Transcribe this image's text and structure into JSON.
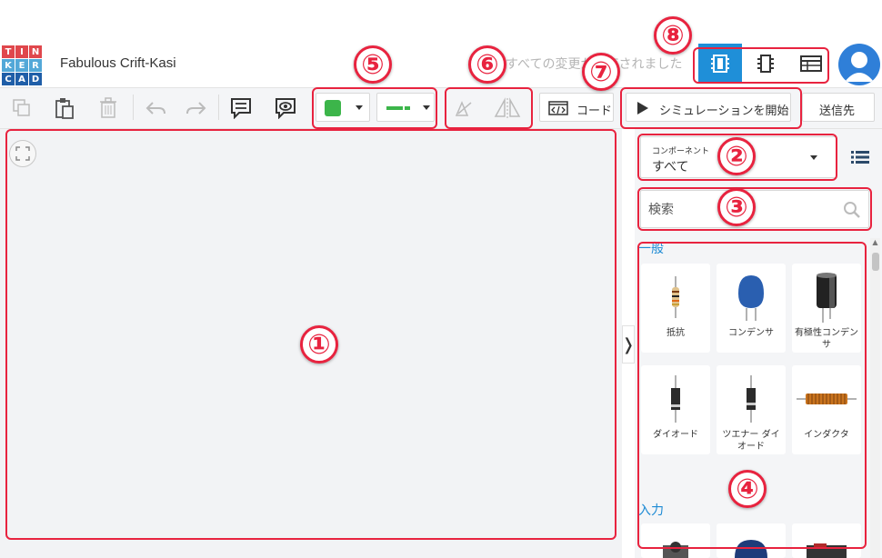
{
  "app": {
    "logo_letters": [
      "T",
      "I",
      "N",
      "K",
      "E",
      "R",
      "C",
      "A",
      "D"
    ],
    "logo_colors": [
      "#e0474c",
      "#e0474c",
      "#e0474c",
      "#53a8d8",
      "#53a8d8",
      "#53a8d8",
      "#1f5ea8",
      "#1f5ea8",
      "#1f5ea8"
    ],
    "project_title": "Fabulous Crift-Kasi",
    "save_status": "すべての変更が保存されました"
  },
  "header": {
    "view_buttons": [
      {
        "icon": "circuit-view-icon",
        "active": true
      },
      {
        "icon": "schematic-view-icon",
        "active": false
      },
      {
        "icon": "component-list-view-icon",
        "active": false
      }
    ],
    "accent_color": "#1f8fd8"
  },
  "toolbar": {
    "code_label": "コード",
    "simulate_label": "シミュレーションを開始",
    "send_label": "送信先",
    "fill_color": "#3cb54a",
    "wire_color": "#3cb54a"
  },
  "panel": {
    "components_small_label": "コンポーネント",
    "components_value": "すべて",
    "search_placeholder": "検索",
    "section_general": "一般",
    "section_input": "入力",
    "general_items": [
      {
        "label": "抵抗",
        "icon": "resistor-icon"
      },
      {
        "label": "コンデンサ",
        "icon": "capacitor-icon"
      },
      {
        "label": "有極性コンデンサ",
        "icon": "polarized-capacitor-icon"
      },
      {
        "label": "ダイオード",
        "icon": "diode-icon"
      },
      {
        "label": "ツエナー ダイオード",
        "icon": "zener-diode-icon"
      },
      {
        "label": "インダクタ",
        "icon": "inductor-icon"
      }
    ]
  },
  "annotations": {
    "color": "#e8233f",
    "labels": [
      "①",
      "②",
      "③",
      "④",
      "⑤",
      "⑥",
      "⑦",
      "⑧"
    ]
  }
}
